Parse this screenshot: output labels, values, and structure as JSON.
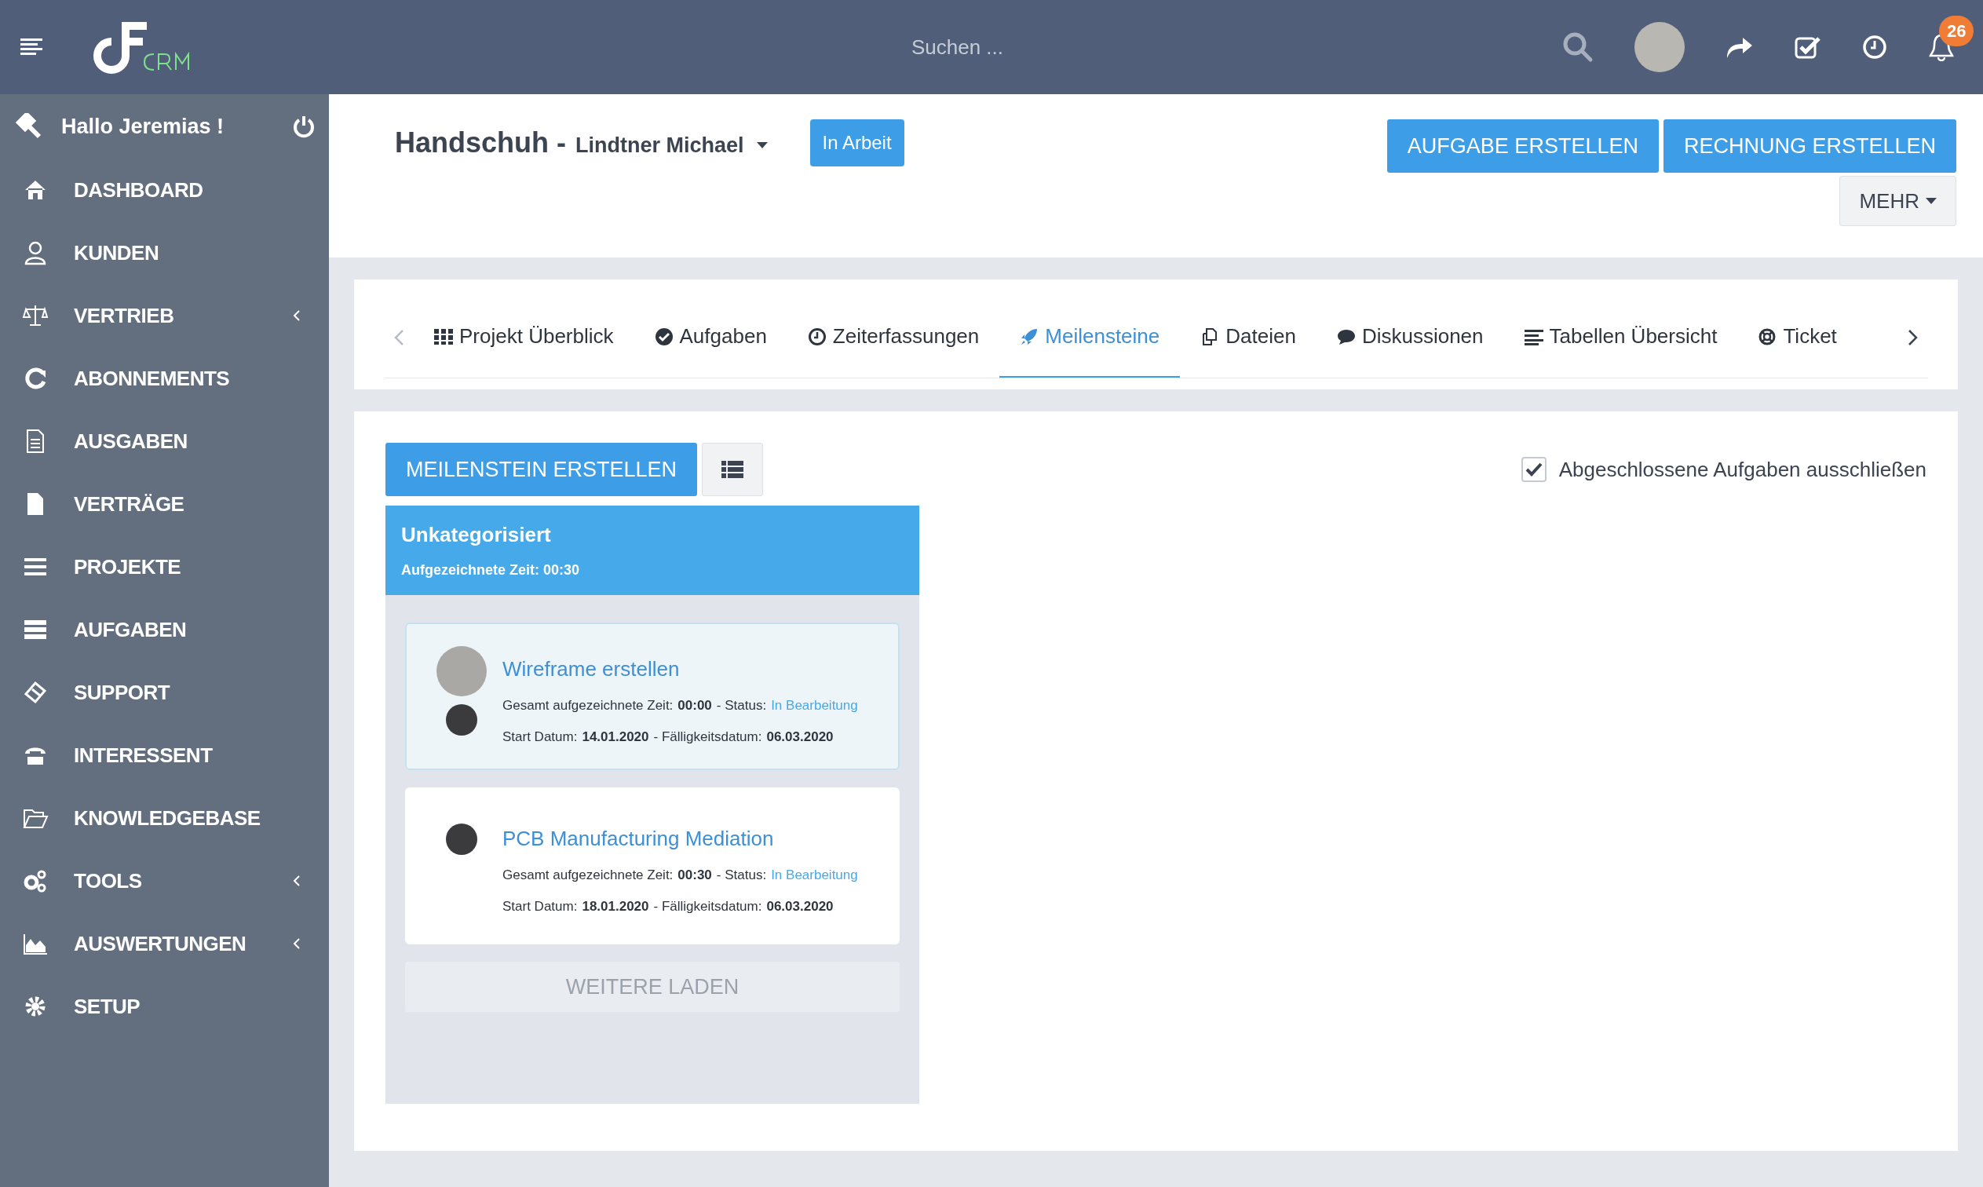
{
  "header": {
    "search": {
      "placeholder": "Suchen ..."
    },
    "notifications": {
      "count": "26"
    }
  },
  "sidebar": {
    "greeting": "Hallo Jeremias !",
    "items": [
      {
        "label": "DASHBOARD",
        "expandable": false
      },
      {
        "label": "KUNDEN",
        "expandable": false
      },
      {
        "label": "VERTRIEB",
        "expandable": true
      },
      {
        "label": "ABONNEMENTS",
        "expandable": false
      },
      {
        "label": "AUSGABEN",
        "expandable": false
      },
      {
        "label": "VERTRÄGE",
        "expandable": false
      },
      {
        "label": "PROJEKTE",
        "expandable": false
      },
      {
        "label": "AUFGABEN",
        "expandable": false
      },
      {
        "label": "SUPPORT",
        "expandable": false
      },
      {
        "label": "INTERESSENT",
        "expandable": false
      },
      {
        "label": "KNOWLEDGEBASE",
        "expandable": false
      },
      {
        "label": "TOOLS",
        "expandable": true
      },
      {
        "label": "AUSWERTUNGEN",
        "expandable": true
      },
      {
        "label": "SETUP",
        "expandable": false
      }
    ]
  },
  "project": {
    "title": "Handschuh -",
    "customer": "Lindtner Michael",
    "status": "In Arbeit",
    "buttons": [
      "AUFGABE ERSTELLEN",
      "RECHNUNG ERSTELLEN"
    ],
    "more": "MEHR"
  },
  "tabs": [
    {
      "label": "Projekt Überblick",
      "selected": false
    },
    {
      "label": "Aufgaben",
      "selected": false
    },
    {
      "label": "Zeiterfassungen",
      "selected": false
    },
    {
      "label": "Meilensteine",
      "selected": true
    },
    {
      "label": "Dateien",
      "selected": false
    },
    {
      "label": "Diskussionen",
      "selected": false
    },
    {
      "label": "Tabellen Übersicht",
      "selected": false
    },
    {
      "label": "Ticket",
      "selected": false
    }
  ],
  "milestones": {
    "create_button": "MEILENSTEIN ERSTELLEN",
    "exclude_completed": {
      "label": "Abgeschlossene Aufgaben ausschließen",
      "checked": true
    },
    "column": {
      "title": "Unkategorisiert",
      "recorded_time": "Aufgezeichnete Zeit: 00:30",
      "tasks": [
        {
          "title": "Wireframe erstellen",
          "highlighted": true,
          "avatars": [
            {
              "kind": "large"
            },
            {
              "kind": "small"
            }
          ],
          "time_label": "Gesamt aufgezeichnete Zeit:",
          "time": "00:00",
          "status_label": "- Status:",
          "status": "In Bearbeitung",
          "start_label": "Start Datum:",
          "start": "14.01.2020",
          "due_label": "- Fälligkeitsdatum:",
          "due": "06.03.2020"
        },
        {
          "title": "PCB Manufacturing Mediation",
          "highlighted": false,
          "avatars": [
            {
              "kind": "small"
            }
          ],
          "time_label": "Gesamt aufgezeichnete Zeit:",
          "time": "00:30",
          "status_label": "- Status:",
          "status": "In Bearbeitung",
          "start_label": "Start Datum:",
          "start": "18.01.2020",
          "due_label": "- Fälligkeitsdatum:",
          "due": "06.03.2020"
        }
      ],
      "load_more": "WEITERE LADEN"
    }
  }
}
